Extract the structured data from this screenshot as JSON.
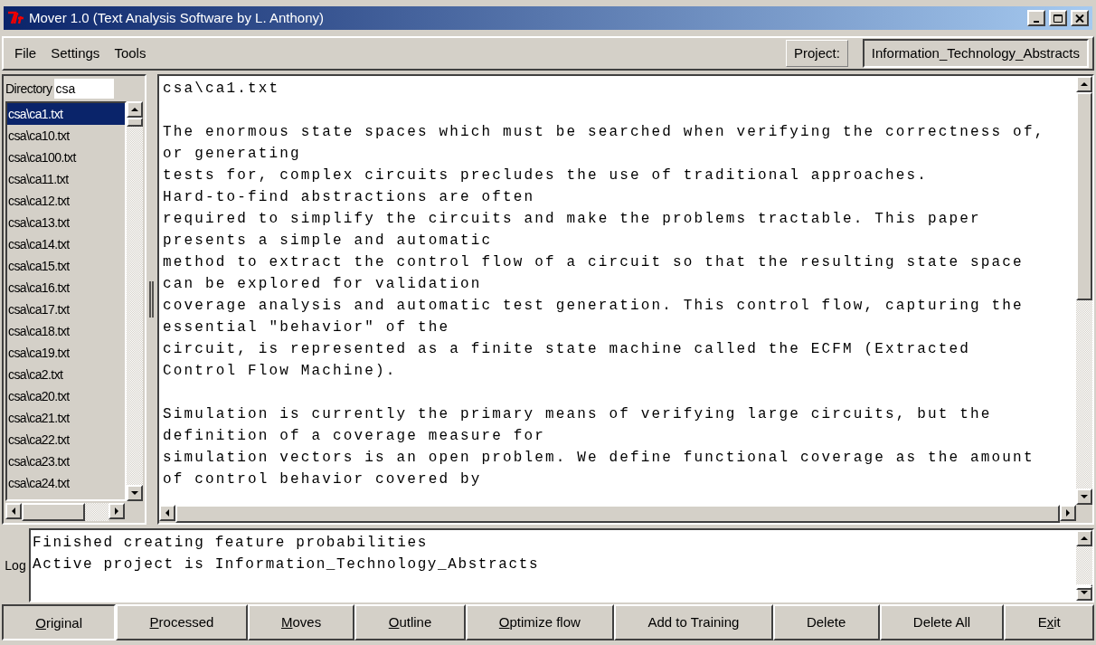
{
  "window": {
    "title": "Mover 1.0 (Text Analysis Software by L. Anthony)"
  },
  "menu": [
    "File",
    "Settings",
    "Tools"
  ],
  "project": {
    "label": "Project:",
    "value": "Information_Technology_Abstracts"
  },
  "directory": {
    "label": "Directory",
    "value": "csa"
  },
  "files": [
    {
      "name": "csa\\ca1.txt",
      "selected": true
    },
    {
      "name": "csa\\ca10.txt",
      "selected": false
    },
    {
      "name": "csa\\ca100.txt",
      "selected": false
    },
    {
      "name": "csa\\ca11.txt",
      "selected": false
    },
    {
      "name": "csa\\ca12.txt",
      "selected": false
    },
    {
      "name": "csa\\ca13.txt",
      "selected": false
    },
    {
      "name": "csa\\ca14.txt",
      "selected": false
    },
    {
      "name": "csa\\ca15.txt",
      "selected": false
    },
    {
      "name": "csa\\ca16.txt",
      "selected": false
    },
    {
      "name": "csa\\ca17.txt",
      "selected": false
    },
    {
      "name": "csa\\ca18.txt",
      "selected": false
    },
    {
      "name": "csa\\ca19.txt",
      "selected": false
    },
    {
      "name": "csa\\ca2.txt",
      "selected": false
    },
    {
      "name": "csa\\ca20.txt",
      "selected": false
    },
    {
      "name": "csa\\ca21.txt",
      "selected": false
    },
    {
      "name": "csa\\ca22.txt",
      "selected": false
    },
    {
      "name": "csa\\ca23.txt",
      "selected": false
    },
    {
      "name": "csa\\ca24.txt",
      "selected": false
    }
  ],
  "document": {
    "heading": "csa\\ca1.txt",
    "paragraphs": [
      [
        "The enormous state spaces which must be searched when verifying the correctness of,",
        "or generating",
        "tests for, complex circuits precludes the use of traditional approaches.",
        "Hard-to-find abstractions are often",
        "required to simplify the circuits and make the problems tractable. This paper",
        "presents a simple and automatic",
        "method to extract the control flow of a circuit so that the resulting state space",
        "can be explored for validation",
        "coverage analysis and automatic test generation. This control flow, capturing the",
        "essential \"behavior\" of the",
        "circuit, is represented as a finite state machine called the ECFM (Extracted",
        "Control Flow Machine)."
      ],
      [
        "Simulation is currently the primary means of verifying large circuits, but the",
        "definition of a coverage measure for",
        "simulation vectors is an open problem. We define functional coverage as the amount",
        "of control behavior covered by"
      ]
    ]
  },
  "log": {
    "label": "Log",
    "lines": [
      "Finished creating feature probabilities",
      "Active project is Information_Technology_Abstracts"
    ]
  },
  "buttons": [
    {
      "mnemonic": "O",
      "label_after": "riginal",
      "selected": true
    },
    {
      "mnemonic": "P",
      "label_after": "rocessed",
      "selected": false
    },
    {
      "mnemonic": "M",
      "label_after": "oves",
      "selected": false
    },
    {
      "mnemonic": "O",
      "label_after": "utline",
      "selected": false
    },
    {
      "mnemonic": "O",
      "label_after": "ptimize flow",
      "selected": false
    },
    {
      "label_before": "Add to Training",
      "selected": false
    },
    {
      "label_before": "Delete",
      "selected": false
    },
    {
      "label_before": "Delete All",
      "selected": false
    },
    {
      "label_before": "E",
      "mnemonic": "x",
      "label_after": "it",
      "selected": false
    }
  ]
}
